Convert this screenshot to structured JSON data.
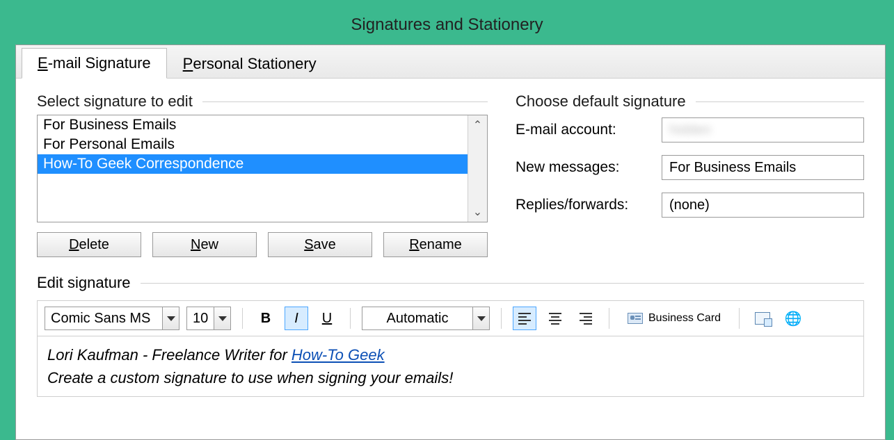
{
  "window": {
    "title": "Signatures and Stationery"
  },
  "tabs": [
    {
      "label_pre": "",
      "label_u": "E",
      "label_post": "-mail Signature"
    },
    {
      "label_pre": "",
      "label_u": "P",
      "label_post": "ersonal Stationery"
    }
  ],
  "left": {
    "group_label": "Select signature to edit",
    "items": [
      "For Business Emails",
      "For Personal Emails",
      "How-To Geek Correspondence"
    ],
    "selected_index": 2,
    "buttons": {
      "delete": {
        "u": "D",
        "rest": "elete"
      },
      "new": {
        "u": "N",
        "rest": "ew"
      },
      "save": {
        "u": "S",
        "rest": "ave"
      },
      "rename": {
        "u": "R",
        "rest": "ename"
      }
    }
  },
  "right": {
    "group_label": "Choose default signature",
    "rows": {
      "email_account": {
        "label_pre": "E-mail ",
        "label_u": "a",
        "label_post": "ccount:",
        "value": ""
      },
      "new_messages": {
        "label_pre": "New ",
        "label_u": "m",
        "label_post": "essages:",
        "value": "For Business Emails"
      },
      "replies": {
        "label_pre": "Replies/",
        "label_u": "f",
        "label_post": "orwards:",
        "value": "(none)"
      }
    }
  },
  "editor": {
    "label_pre": "Edi",
    "label_u": "t",
    "label_post": " signature",
    "font_name": "Comic Sans MS",
    "font_size": "10",
    "color_label": "Automatic",
    "bold": false,
    "italic": true,
    "underline": false,
    "align": "left",
    "business_card": {
      "u": "B",
      "rest": "usiness Card"
    },
    "content_line1_pre": "Lori Kaufman - Freelance Writer for ",
    "content_link_text": "How-To Geek",
    "content_line2": "Create a custom signature to use when signing your emails!"
  }
}
